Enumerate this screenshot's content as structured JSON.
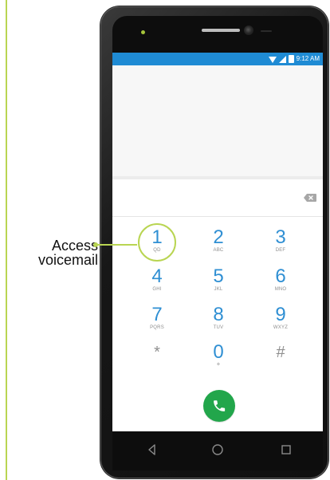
{
  "status_bar": {
    "time": "9:12 AM"
  },
  "annotation": {
    "line1": "Access",
    "line2": "voicemail"
  },
  "dialpad": {
    "keys": [
      {
        "main": "1",
        "sub": "QD"
      },
      {
        "main": "2",
        "sub": "ABC"
      },
      {
        "main": "3",
        "sub": "DEF"
      },
      {
        "main": "4",
        "sub": "GHI"
      },
      {
        "main": "5",
        "sub": "JKL"
      },
      {
        "main": "6",
        "sub": "MNO"
      },
      {
        "main": "7",
        "sub": "PQRS"
      },
      {
        "main": "8",
        "sub": "TUV"
      },
      {
        "main": "9",
        "sub": "WXYZ"
      },
      {
        "main": "*",
        "sub": ""
      },
      {
        "main": "0",
        "sub": "+"
      },
      {
        "main": "#",
        "sub": ""
      }
    ]
  },
  "icons": {
    "wifi": "wifi-icon",
    "signal": "signal-icon",
    "battery": "battery-icon",
    "backspace": "backspace-icon",
    "call": "phone-icon",
    "back": "back-icon",
    "home": "home-icon",
    "recent": "recent-apps-icon"
  },
  "colors": {
    "accent_blue": "#2f8fd3",
    "status_blue": "#1f8bd4",
    "call_green": "#22a64b",
    "highlight_green": "#b9d552"
  }
}
